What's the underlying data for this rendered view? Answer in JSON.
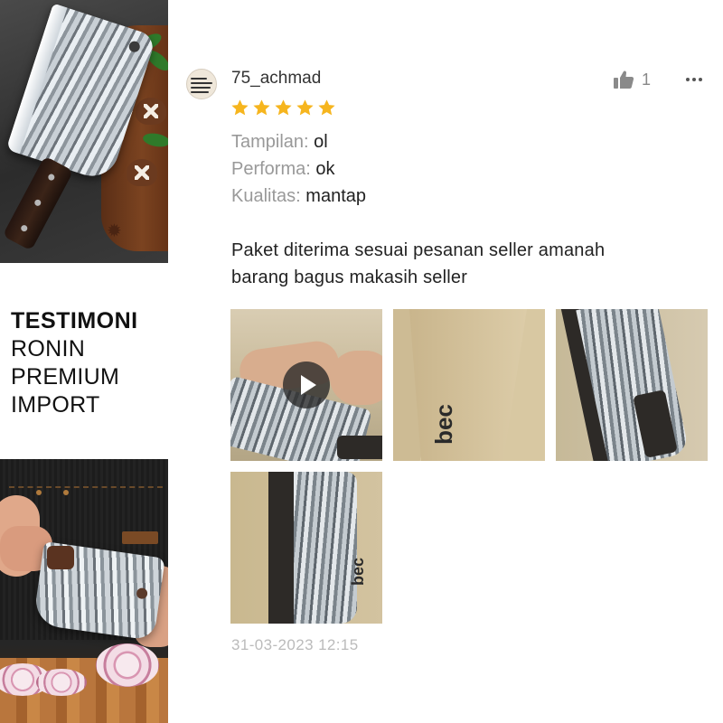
{
  "promo": {
    "title": "TESTIMONI",
    "lines": [
      "RONIN",
      "PREMIUM",
      "IMPORT"
    ]
  },
  "review": {
    "username": "75_achmad",
    "likes": "1",
    "rating": 5,
    "star_color": "#f6b51e",
    "attributes": [
      {
        "label": "Tampilan:",
        "value": "ol"
      },
      {
        "label": "Performa:",
        "value": "ok"
      },
      {
        "label": "Kualitas:",
        "value": "mantap"
      }
    ],
    "comment_lines": [
      "Paket diterima sesuai pesanan seller amanah",
      "barang bagus makasih seller"
    ],
    "media": [
      {
        "type": "video",
        "icon": "play-icon"
      },
      {
        "type": "image",
        "logo": "bec"
      },
      {
        "type": "image"
      },
      {
        "type": "image",
        "logo": "bec"
      }
    ],
    "timestamp": "31-03-2023 12:15"
  },
  "icons": {
    "like": "thumbs-up-icon",
    "more": "more-options-icon",
    "star": "star-icon",
    "play": "play-icon"
  }
}
